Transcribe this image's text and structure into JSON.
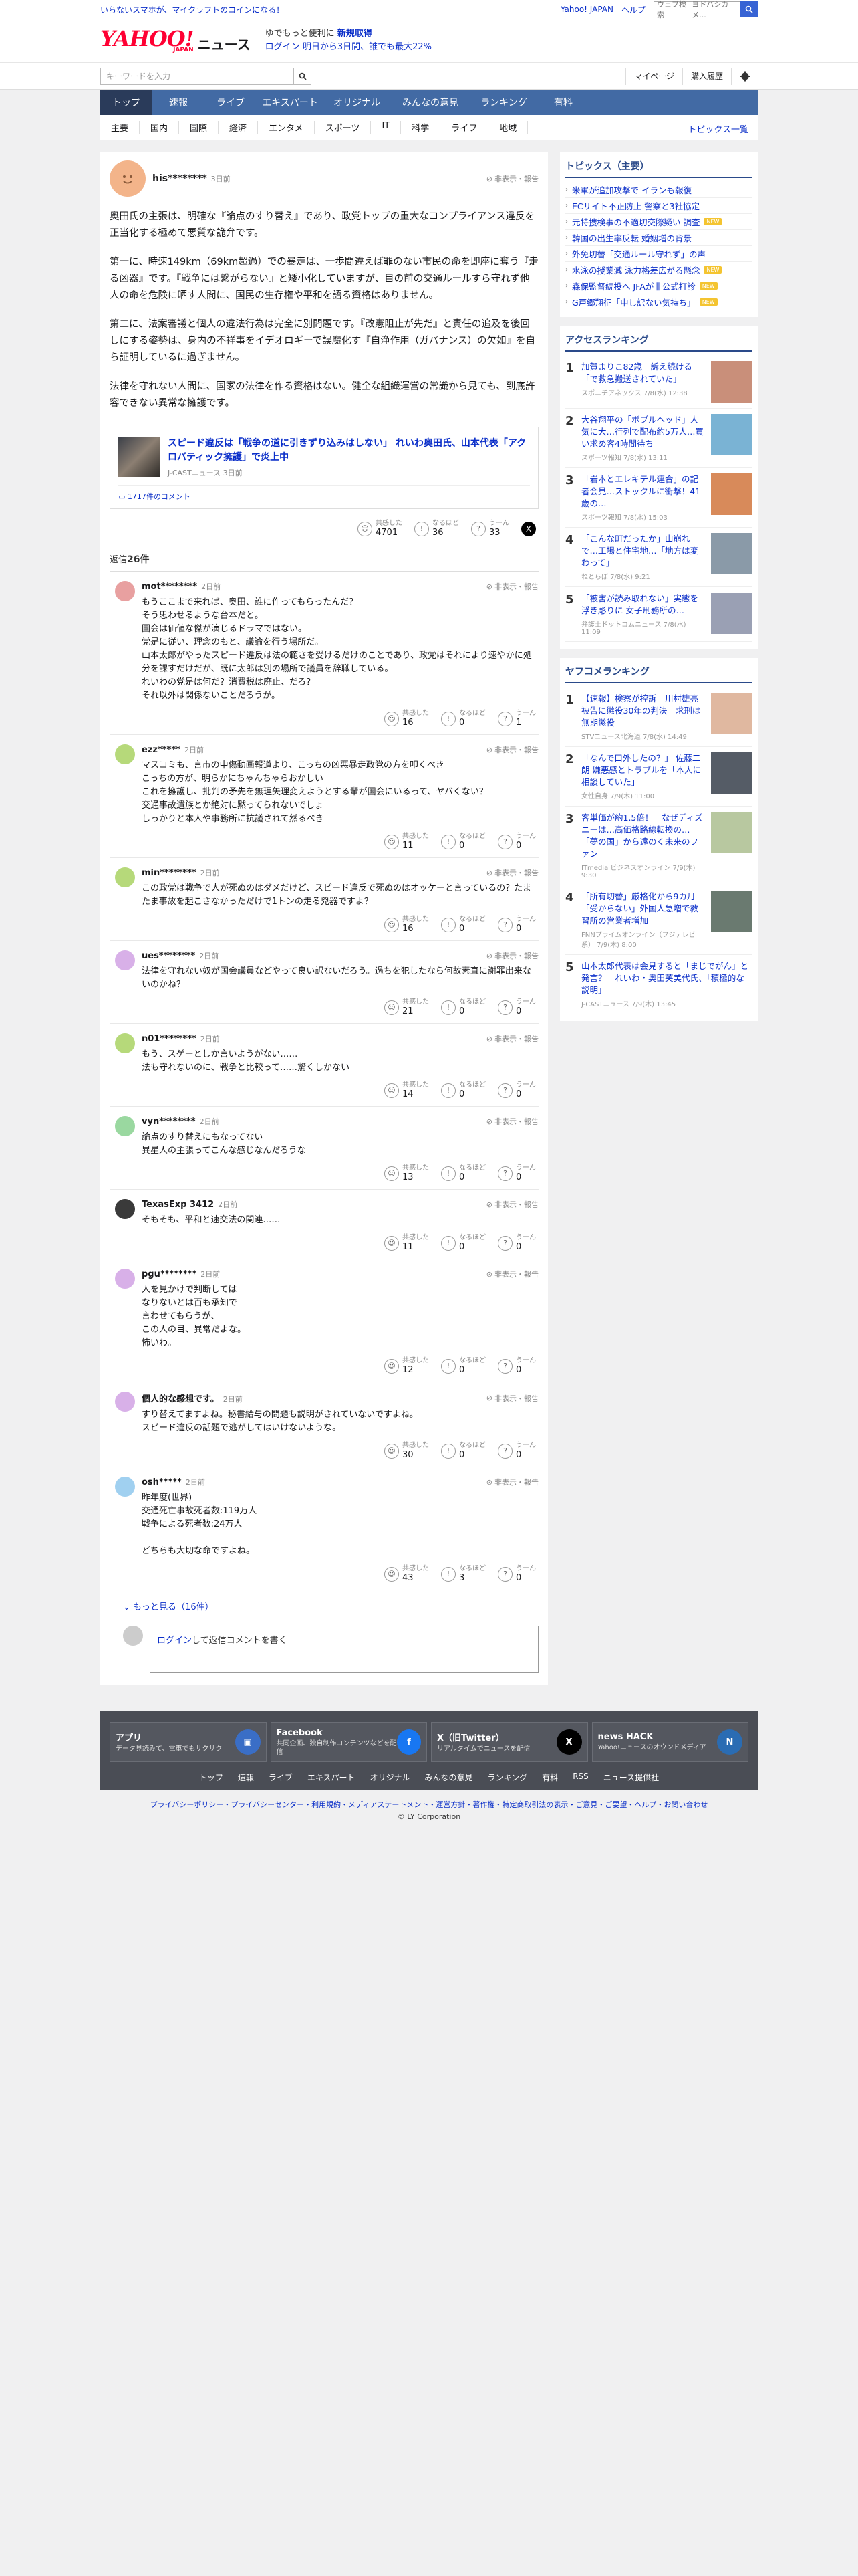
{
  "topstrip": {
    "promo": "いらないスマホが、マイクラフトのコインになる！",
    "yahoo_link": "Yahoo! JAPAN",
    "help": "ヘルプ",
    "web_search_placeholder": "ウェブ検索",
    "web_search_value": "ヨドバシカメ..."
  },
  "header": {
    "logo_text": "YAHOO!",
    "logo_sub": "JAPAN",
    "service": "ニュース",
    "promo_a1": "ゆでもっと便利に",
    "promo_a2": "新規取得",
    "promo_b1": "ログイン",
    "promo_b2": "明日から3日間、誰でも最大22%"
  },
  "search": {
    "placeholder": "キーワードを入力",
    "mypage": "マイページ",
    "history": "購入履歴"
  },
  "nav": {
    "tabs": [
      {
        "label": "トップ"
      },
      {
        "label": "速報"
      },
      {
        "label": "ライブ"
      },
      {
        "label": "エキスパート"
      },
      {
        "label": "オリジナル"
      },
      {
        "label": "みんなの意見"
      },
      {
        "label": "ランキング"
      },
      {
        "label": "有料"
      }
    ]
  },
  "subnav": {
    "items": [
      "主要",
      "国内",
      "国際",
      "経済",
      "エンタメ",
      "スポーツ",
      "IT",
      "科学",
      "ライフ",
      "地域"
    ],
    "more": "トピックス一覧"
  },
  "post": {
    "user": "his********",
    "time": "3日前",
    "report": "非表示・報告",
    "paragraphs": [
      "奥田氏の主張は、明確な『論点のすり替え』であり、政党トップの重大なコンプライアンス違反を正当化する極めて悪質な詭弁です。",
      "第一に、時速149km（69km超過）での暴走は、一歩間違えば罪のない市民の命を即座に奪う『走る凶器』です。『戦争には繋がらない』と矮小化していますが、目の前の交通ルールすら守れず他人の命を危険に晒す人間に、国民の生存権や平和を語る資格はありません。",
      "第二に、法案審議と個人の違法行為は完全に別問題です。『改憲阻止が先だ』と責任の追及を後回しにする姿勢は、身内の不祥事をイデオロギーで誤魔化す『自浄作用（ガバナンス）の欠如』を自ら証明しているに過ぎません。",
      "法律を守れない人間に、国家の法律を作る資格はない。健全な組織運営の常識から見ても、到底許容できない異常な擁護です。"
    ],
    "article": {
      "title": "スピード違反は「戦争の道に引きずり込みはしない」 れいわ奥田氏、山本代表「アクロバティック擁護」で炎上中",
      "source": "J-CASTニュース 3日前",
      "comments": "1717件のコメント"
    },
    "reactions": {
      "agree_label": "共感した",
      "agree": "4701",
      "insight_label": "なるほど",
      "insight": "36",
      "hmm_label": "うーん",
      "hmm": "33"
    }
  },
  "replies_header": {
    "prefix": "返信",
    "count": "26件"
  },
  "replies": [
    {
      "user": "mot********",
      "time": "2日前",
      "color": "#e8a0a0",
      "text": "もうここまで来れば、奥田、誰に作ってもらったんだ？\nそう思わせるような台本だと。\n国会は価値な傑が演じるドラマではない。\n党是に従い、理念のもと、議論を行う場所だ。\n山本太郎がやったスピード違反は法の範さを受けるだけのことであり、政党はそれにより速やかに処分を課すだけだが、既に太郎は別の場所で議員を辞職している。\nれいわの党是は何だ？消費税は廃止、だろ？\nそれ以外は関係ないことだろうが。",
      "a": "16",
      "b": "0",
      "c": "1"
    },
    {
      "user": "ezz*****",
      "time": "2日前",
      "color": "#b6d97a",
      "text": "マスコミも、言市の中傷動画報道より、こっちの凶悪暴走政党の方を叩くべき\nこっちの方が、明らかにちゃんちゃらおかしい\nこれを擁護し、批判の矛先を無理矢理変えようとする輩が国会にいるって、ヤバくない？\n交通事故遺族とか絶対に黙ってられないでしょ\nしっかりと本人や事務所に抗議されて然るべき",
      "a": "11",
      "b": "0",
      "c": "0"
    },
    {
      "user": "min********",
      "time": "2日前",
      "color": "#b6d97a",
      "text": "この政党は戦争で人が死ぬのはダメだけど、スピード違反で死ぬのはオッケーと言っているの？たまたま事故を起こさなかっただけで1トンの走る兇器ですよ？",
      "a": "16",
      "b": "0",
      "c": "0"
    },
    {
      "user": "ues********",
      "time": "2日前",
      "color": "#d8b0e8",
      "text": "法律を守れない奴が国会議員などやって良い訳ないだろう。過ちを犯したなら何故素直に謝罪出来ないのかね？",
      "a": "21",
      "b": "0",
      "c": "0"
    },
    {
      "user": "n01********",
      "time": "2日前",
      "color": "#b6d97a",
      "text": "もう、スゲーとしか言いようがない……\n法も守れないのに、戦争と比較って……驚くしかない",
      "a": "14",
      "b": "0",
      "c": "0"
    },
    {
      "user": "vyn********",
      "time": "2日前",
      "color": "#9ad8a0",
      "text": "論点のすり替えにもなってない\n異星人の主張ってこんな感じなんだろうな",
      "a": "13",
      "b": "0",
      "c": "0"
    },
    {
      "user": "TexasExp 3412",
      "time": "2日前",
      "color": "#3a3a3a",
      "text": "そもそも、平和と速交法の関連……",
      "a": "11",
      "b": "0",
      "c": "0"
    },
    {
      "user": "pgu********",
      "time": "2日前",
      "color": "#d8b0e8",
      "text": "人を見かけで判断しては\nなりないとは百も承知で\n言わせてもらうが、\nこの人の目、異常だよな。\n怖いわ。",
      "a": "12",
      "b": "0",
      "c": "0"
    },
    {
      "user": "個人的な感想です。",
      "time": "2日前",
      "color": "#d8b0e8",
      "text": "すり替えてますよね。秘書給与の問題も説明がされていないですよね。\nスピード違反の話題で逃がしてはいけないような。",
      "a": "30",
      "b": "0",
      "c": "0"
    },
    {
      "user": "osh*****",
      "time": "2日前",
      "color": "#a0d0f0",
      "text": "昨年度(世界)\n交通死亡事故死者数:119万人\n戦争による死者数:24万人\n\nどちらも大切な命ですよね。",
      "a": "43",
      "b": "3",
      "c": "0"
    }
  ],
  "more_replies": "もっと見る（16件）",
  "reply_input": {
    "login": "ログイン",
    "rest": "して返信コメントを書く"
  },
  "topics": {
    "title": "トピックス（主要）",
    "items": [
      {
        "text": "米軍が追加攻撃で イランも報復",
        "tag": ""
      },
      {
        "text": "ECサイト不正防止 警察と3社協定",
        "tag": ""
      },
      {
        "text": "元特捜検事の不適切交際疑い 調査",
        "tag": "NEW"
      },
      {
        "text": "韓国の出生率反転 婚姻増の背景",
        "tag": ""
      },
      {
        "text": "外免切替「交通ルール守れず」の声",
        "tag": ""
      },
      {
        "text": "水泳の授業減 泳力格差広がる懸念",
        "tag": "NEW"
      },
      {
        "text": "森保監督続投へ JFAが非公式打診",
        "tag": "NEW"
      },
      {
        "text": "G戸郷翔征「申し訳ない気持ち」",
        "tag": "NEW"
      }
    ]
  },
  "access": {
    "title": "アクセスランキング",
    "items": [
      {
        "n": "1",
        "title": "加賀まりこ82歳　訴え続ける「で救急搬送されていた」",
        "src": "スポニチアネックス 7/8(水) 12:38",
        "img": "#c98f7a"
      },
      {
        "n": "2",
        "title": "大谷翔平の「ボブルヘッド」人気に大…行列で配布約5万人…買い求め客4時間待ち",
        "src": "スポーツ報知 7/8(水) 13:11",
        "img": "#7ab3d4"
      },
      {
        "n": "3",
        "title": "「岩本とエレキテル連合」の記者会見…ストックルに衝撃！41歳の…",
        "src": "スポーツ報知 7/8(水) 15:03",
        "img": "#d88a5a"
      },
      {
        "n": "4",
        "title": "「こんな町だったか」山崩れで…工場と住宅地…「地方は変わって」",
        "src": "ねとらぼ 7/8(水) 9:21",
        "img": "#8a9aa8"
      },
      {
        "n": "5",
        "title": "「被害が読み取れない」実態を浮き彫りに 女子刑務所の…",
        "src": "弁護士ドットコムニュース 7/8(水) 11:09",
        "img": "#9aa0b4"
      }
    ]
  },
  "yafuko": {
    "title": "ヤフコメランキング",
    "items": [
      {
        "n": "1",
        "title": "【速報】検察が控訴　川村雄亮被告に懲役30年の判決　求刑は無期懲役",
        "src": "STVニュース北海道 7/8(水) 14:49",
        "img": "#e0b8a0"
      },
      {
        "n": "2",
        "title": "「なんで口外したの？」 佐藤二朗 嫌悪感とトラブルを「本人に相談していた」",
        "src": "女性自身 7/9(木) 11:00",
        "img": "#555c66"
      },
      {
        "n": "3",
        "title": "客単価が約1.5倍！　なぜディズニーは…高価格路線転換の…「夢の国」から遠のく未来のファン",
        "src": "ITmedia ビジネスオンライン 7/9(木) 9:30",
        "img": "#b8c8a0"
      },
      {
        "n": "4",
        "title": "「所有切替」厳格化から9カ月「受からない」外国人急増で教習所の営業者増加",
        "src": "FNNプライムオンライン（フジテレビ系） 7/9(木) 8:00",
        "img": "#6a7a70"
      },
      {
        "n": "5",
        "title": "山本太郎代表は会見すると「まじでがん」と発言？　れいわ・奥田芙美代氏、「積極的な説明」",
        "src": "J-CASTニュース 7/9(木) 13:45",
        "img": ""
      }
    ]
  },
  "footer": {
    "cards": [
      {
        "title": "アプリ",
        "desc": "データ見読みて、電車でもサクサク",
        "icon": "app-icon",
        "color": "#3a6ec6"
      },
      {
        "title": "Facebook",
        "desc": "共同企画、独自制作コンテンツなどを配信",
        "icon": "facebook-icon",
        "color": "#1877f2"
      },
      {
        "title": "X（旧Twitter）",
        "desc": "リアルタイムでニュースを配信",
        "icon": "x-icon",
        "color": "#000000"
      },
      {
        "title": "news HACK",
        "desc": "Yahoo!ニュースのオウンドメディア",
        "icon": "newshack-icon",
        "color": "#2a6cb3"
      }
    ],
    "links": [
      "トップ",
      "速報",
      "ライブ",
      "エキスパート",
      "オリジナル",
      "みんなの意見",
      "ランキング",
      "有料",
      "RSS",
      "ニュース提供社"
    ],
    "legal": "プライバシーポリシー・プライバシーセンター・利用規約・メディアステートメント・運営方針・著作権・特定商取引法の表示・ご意見・ご要望・ヘルプ・お問い合わせ",
    "copyright": "© LY Corporation"
  },
  "colors": {
    "accent": "#426aa4",
    "active_tab": "#2a3b5a",
    "link": "#0b2fc9",
    "brand": "#ff0033"
  }
}
